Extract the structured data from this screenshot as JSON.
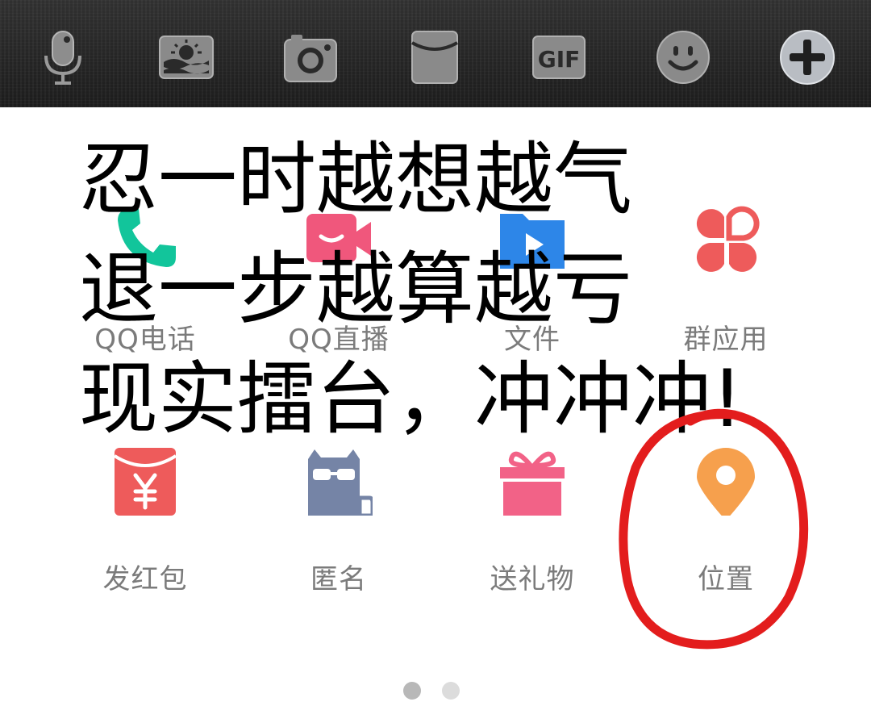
{
  "toolbar": {
    "items": [
      {
        "name": "voice",
        "icon": "microphone-icon"
      },
      {
        "name": "photo",
        "icon": "picture-icon"
      },
      {
        "name": "camera",
        "icon": "camera-icon"
      },
      {
        "name": "red-packet",
        "icon": "red-packet-icon"
      },
      {
        "name": "gif",
        "icon": "gif-icon",
        "text": "GIF"
      },
      {
        "name": "emoji",
        "icon": "smiley-icon"
      },
      {
        "name": "more",
        "icon": "plus-icon"
      }
    ]
  },
  "panel": {
    "row1": [
      {
        "label": "QQ电话",
        "icon": "phone-icon",
        "color": "#12c59b"
      },
      {
        "label": "QQ直播",
        "icon": "video-camera-icon",
        "color": "#f0577c"
      },
      {
        "label": "文件",
        "icon": "folder-icon",
        "color": "#2d86e8"
      },
      {
        "label": "群应用",
        "icon": "apps-icon",
        "color": "#ee5b5b"
      }
    ],
    "row2": [
      {
        "label": "发红包",
        "icon": "red-envelope-icon",
        "color": "#ee5b5b"
      },
      {
        "label": "匿名",
        "icon": "anonymous-icon",
        "color": "#7584a6"
      },
      {
        "label": "送礼物",
        "icon": "gift-icon",
        "color": "#f26287"
      },
      {
        "label": "位置",
        "icon": "location-pin-icon",
        "color": "#f6a04d"
      }
    ]
  },
  "overlay_text": {
    "line1": "忍一时越想越气",
    "line2": "退一步越算越亏",
    "line3": "现实擂台，冲冲冲!"
  },
  "pagination": {
    "current": 1,
    "total": 2,
    "active_color": "#b8b8b8",
    "inactive_color": "#dcdcdc"
  },
  "annotation": {
    "color": "#e31d1d"
  }
}
